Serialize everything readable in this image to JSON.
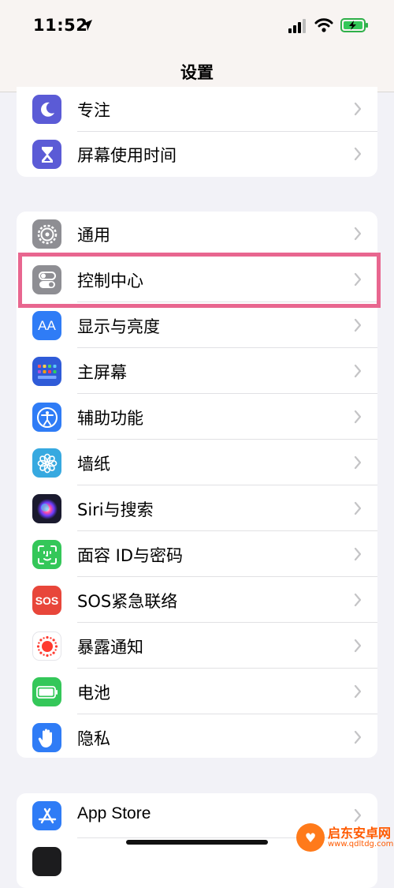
{
  "status": {
    "time": "11:52",
    "location_icon": "location-arrow-icon",
    "signal_icon": "cellular-signal-icon",
    "wifi_icon": "wifi-icon",
    "battery_icon": "battery-charging-icon"
  },
  "nav": {
    "title": "设置"
  },
  "group1": [
    {
      "label": "专注",
      "icon": "moon-icon",
      "color": "#5b5bd6"
    },
    {
      "label": "屏幕使用时间",
      "icon": "hourglass-icon",
      "color": "#5b5bd6"
    }
  ],
  "group2": [
    {
      "label": "通用",
      "icon": "gear-icon",
      "color": "#8e8e93"
    },
    {
      "label": "控制中心",
      "icon": "toggles-icon",
      "color": "#8e8e93"
    },
    {
      "label": "显示与亮度",
      "icon": "text-size-icon",
      "color": "#2f7cf6"
    },
    {
      "label": "主屏幕",
      "icon": "home-grid-icon",
      "color": "#2f5bd8"
    },
    {
      "label": "辅助功能",
      "icon": "accessibility-icon",
      "color": "#2f7cf6"
    },
    {
      "label": "墙纸",
      "icon": "flower-icon",
      "color": "#37a9e0"
    },
    {
      "label": "Siri与搜索",
      "icon": "siri-icon",
      "color": "#1a1a2e"
    },
    {
      "label": "面容 ID与密码",
      "icon": "face-id-icon",
      "color": "#34c759"
    },
    {
      "label": "SOS紧急联络",
      "icon": "sos-icon",
      "color": "#e8463a"
    },
    {
      "label": "暴露通知",
      "icon": "exposure-icon",
      "color": "#ffffff"
    },
    {
      "label": "电池",
      "icon": "battery-icon",
      "color": "#34c759"
    },
    {
      "label": "隐私",
      "icon": "hand-icon",
      "color": "#2f7cf6"
    }
  ],
  "group3": [
    {
      "label": "App Store",
      "icon": "app-store-icon",
      "color": "#2f7cf6"
    }
  ],
  "sos_text": "SOS",
  "aa_text": "AA",
  "highlight_color": "#e8668f",
  "watermark": {
    "logo_text": "♥",
    "title": "启东安卓网",
    "url": "www.qdltdg.com"
  }
}
